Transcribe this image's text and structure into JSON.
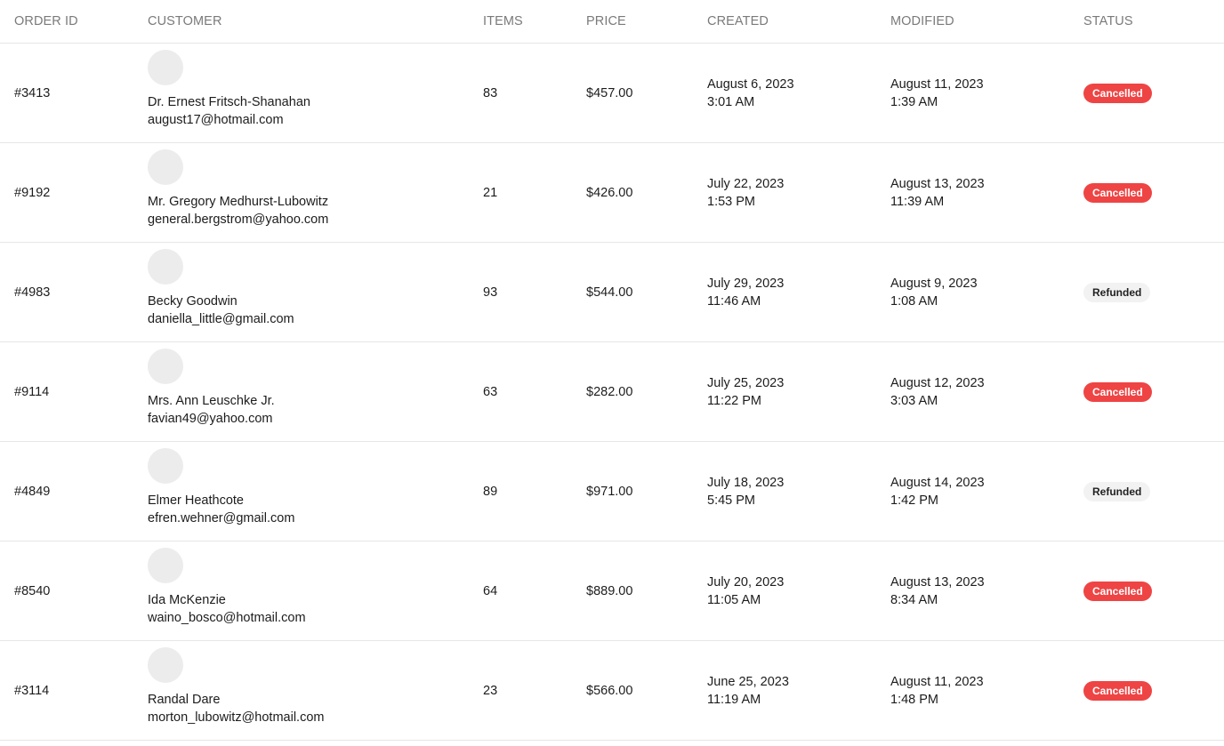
{
  "columns": {
    "order_id": "ORDER ID",
    "customer": "CUSTOMER",
    "items": "ITEMS",
    "price": "PRICE",
    "created": "CREATED",
    "modified": "MODIFIED",
    "status": "STATUS"
  },
  "status_colors": {
    "Cancelled": "#ef4444",
    "Refunded": "#f2f2f2"
  },
  "orders": [
    {
      "id": "#3413",
      "customer_name": "Dr. Ernest Fritsch-Shanahan",
      "customer_email": "august17@hotmail.com",
      "items": "83",
      "price": "$457.00",
      "created_date": "August 6, 2023",
      "created_time": "3:01 AM",
      "modified_date": "August 11, 2023",
      "modified_time": "1:39 AM",
      "status": "Cancelled"
    },
    {
      "id": "#9192",
      "customer_name": "Mr. Gregory Medhurst-Lubowitz",
      "customer_email": "general.bergstrom@yahoo.com",
      "items": "21",
      "price": "$426.00",
      "created_date": "July 22, 2023",
      "created_time": "1:53 PM",
      "modified_date": "August 13, 2023",
      "modified_time": "11:39 AM",
      "status": "Cancelled"
    },
    {
      "id": "#4983",
      "customer_name": "Becky Goodwin",
      "customer_email": "daniella_little@gmail.com",
      "items": "93",
      "price": "$544.00",
      "created_date": "July 29, 2023",
      "created_time": "11:46 AM",
      "modified_date": "August 9, 2023",
      "modified_time": "1:08 AM",
      "status": "Refunded"
    },
    {
      "id": "#9114",
      "customer_name": "Mrs. Ann Leuschke Jr.",
      "customer_email": "favian49@yahoo.com",
      "items": "63",
      "price": "$282.00",
      "created_date": "July 25, 2023",
      "created_time": "11:22 PM",
      "modified_date": "August 12, 2023",
      "modified_time": "3:03 AM",
      "status": "Cancelled"
    },
    {
      "id": "#4849",
      "customer_name": "Elmer Heathcote",
      "customer_email": "efren.wehner@gmail.com",
      "items": "89",
      "price": "$971.00",
      "created_date": "July 18, 2023",
      "created_time": "5:45 PM",
      "modified_date": "August 14, 2023",
      "modified_time": "1:42 PM",
      "status": "Refunded"
    },
    {
      "id": "#8540",
      "customer_name": "Ida McKenzie",
      "customer_email": "waino_bosco@hotmail.com",
      "items": "64",
      "price": "$889.00",
      "created_date": "July 20, 2023",
      "created_time": "11:05 AM",
      "modified_date": "August 13, 2023",
      "modified_time": "8:34 AM",
      "status": "Cancelled"
    },
    {
      "id": "#3114",
      "customer_name": "Randal Dare",
      "customer_email": "morton_lubowitz@hotmail.com",
      "items": "23",
      "price": "$566.00",
      "created_date": "June 25, 2023",
      "created_time": "11:19 AM",
      "modified_date": "August 11, 2023",
      "modified_time": "1:48 PM",
      "status": "Cancelled"
    }
  ]
}
